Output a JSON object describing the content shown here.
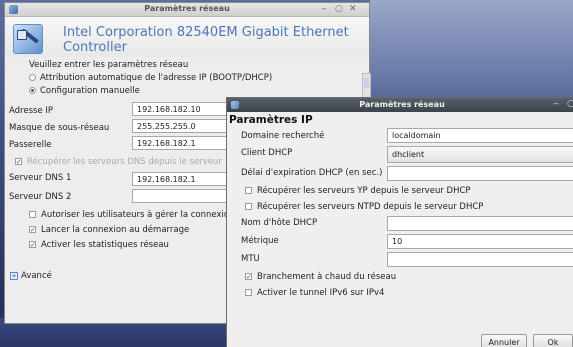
{
  "back_window": {
    "title": "Paramètres réseau",
    "controls": {
      "minimize": "‒",
      "restore": "○",
      "close": "✕"
    },
    "header_title": "Intel Corporation 82540EM Gigabit Ethernet Controller",
    "instruction": "Veuillez entrer les paramètres réseau",
    "radio_auto": "Attribution automatique de l'adresse IP (BOOTP/DHCP)",
    "radio_manual": "Configuration manuelle",
    "fields": [
      {
        "label": "Adresse IP",
        "value": "192.168.182.10"
      },
      {
        "label": "Masque de sous-réseau",
        "value": "255.255.255.0"
      },
      {
        "label": "Passerelle",
        "value": "192.168.182.1"
      }
    ],
    "dns_checkbox": "Récupérer les serveurs DNS depuis le serveur",
    "dns1_label": "Serveur DNS 1",
    "dns1_value": "192.168.182.1",
    "dns2_label": "Serveur DNS 2",
    "dns2_value": "",
    "options": [
      "Autoriser les utilisateurs à gérer la connexion",
      "Lancer la connexion au démarrage",
      "Activer les statistiques réseau"
    ],
    "advanced": "Avancé",
    "expander_glyph": "+"
  },
  "front_window": {
    "title": "Paramètres réseau",
    "controls": {
      "minimize": "‒",
      "restore": "○"
    },
    "section_title": "Paramètres IP",
    "search_domain_label": "Domaine recherché",
    "search_domain_value": "localdomain",
    "dhcp_client_label": "Client DHCP",
    "dhcp_client_value": "dhclient",
    "dhcp_timeout_label": "Délai d'expiration DHCP (en sec.)",
    "dhcp_timeout_value": "",
    "yp_checkbox": "Récupérer les serveurs YP depuis le serveur DHCP",
    "ntpd_checkbox": "Récupérer les serveurs NTPD depuis le serveur DHCP",
    "hostname_label": "Nom d'hôte DHCP",
    "hostname_value": "",
    "metric_label": "Métrique",
    "metric_value": "10",
    "mtu_label": "MTU",
    "mtu_value": "",
    "hotplug_checkbox": "Branchement à chaud du réseau",
    "ipv6_checkbox": "Activer le tunnel IPv6 sur IPv4",
    "cancel_button": "Annuler",
    "ok_button": "Ok"
  },
  "checkbox_glyph": "✓",
  "colors": {
    "desktop": "#3d4f82",
    "front_titlebar": "#3c424b",
    "header_text": "#4a77b8"
  }
}
